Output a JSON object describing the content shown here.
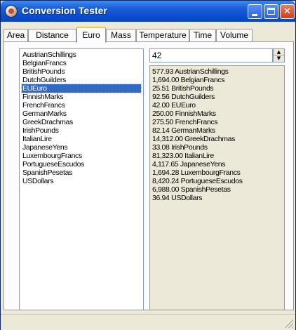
{
  "window": {
    "title": "Conversion Tester"
  },
  "colors": {
    "titlebar": "#0a4fd0",
    "selection": "#316ac5",
    "tab_highlight": "#ffc83c"
  },
  "tabs": [
    {
      "label": "Area",
      "active": false
    },
    {
      "label": "Distance",
      "active": false
    },
    {
      "label": "Euro",
      "active": true
    },
    {
      "label": "Mass",
      "active": false
    },
    {
      "label": "Temperature",
      "active": false
    },
    {
      "label": "Time",
      "active": false
    },
    {
      "label": "Volume",
      "active": false
    }
  ],
  "currency_list": {
    "items": [
      "AustrianSchillings",
      "BelgianFrancs",
      "BritishPounds",
      "DutchGuilders",
      "EUEuro",
      "FinnishMarks",
      "FrenchFrancs",
      "GermanMarks",
      "GreekDrachmas",
      "IrishPounds",
      "ItalianLire",
      "JapaneseYens",
      "LuxembourgFrancs",
      "PortugueseEscudos",
      "SpanishPesetas",
      "USDollars"
    ],
    "selected": "EUEuro"
  },
  "amount": {
    "value": "42"
  },
  "results": [
    "577.93 AustrianSchillings",
    "1,694.00 BelgianFrancs",
    "25.51 BritishPounds",
    "92.56 DutchGuilders",
    "42.00 EUEuro",
    "250.00 FinnishMarks",
    "275.50 FrenchFrancs",
    "82.14 GermanMarks",
    "14,312.00 GreekDrachmas",
    "33.08 IrishPounds",
    "81,323.00 ItalianLire",
    "4,117.65 JapaneseYens",
    "1,694.28 LuxembourgFrancs",
    "8,420.24 PortugueseEscudos",
    "6,988.00 SpanishPesetas",
    "36.94 USDollars"
  ]
}
